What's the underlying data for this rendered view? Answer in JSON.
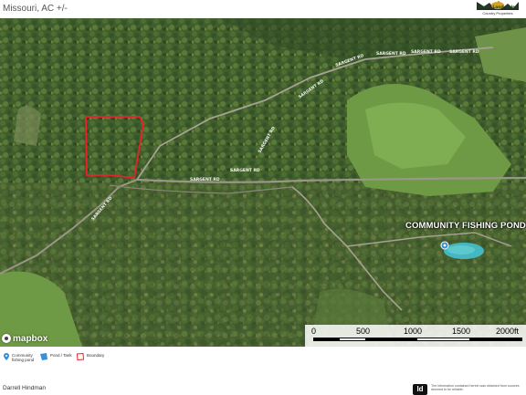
{
  "header": {
    "title": "Missouri,  AC +/-",
    "logo_text": "Ozark Land Sales",
    "logo_sub": "Country Properties"
  },
  "map": {
    "road_labels": [
      "SARGENT RD",
      "SARGENT RD",
      "SARGENT RD",
      "SARGENT RD",
      "SARGENT RD",
      "SARGENT RD",
      "SARGENT RD",
      "SARGENT RD",
      "SARGENT RD"
    ],
    "pond_label": "COMMUNITY FISHING POND",
    "attribution": "mapbox",
    "boundary_color": "#e8232b",
    "pond_marker_color": "#3a8fd6"
  },
  "scale": {
    "labels": [
      "0",
      "500",
      "1000",
      "1500",
      "2000ft"
    ]
  },
  "legend": {
    "items": [
      {
        "icon": "pin-icon",
        "label": "Community fishing pond"
      },
      {
        "icon": "pond-tank-icon",
        "label": "Pond / Tank"
      },
      {
        "icon": "boundary-icon",
        "label": "Boundary"
      }
    ]
  },
  "footer": {
    "agent": "Darrell Hindman",
    "disclaimer": "The information contained herein was obtained from sources deemed to be reliable."
  }
}
